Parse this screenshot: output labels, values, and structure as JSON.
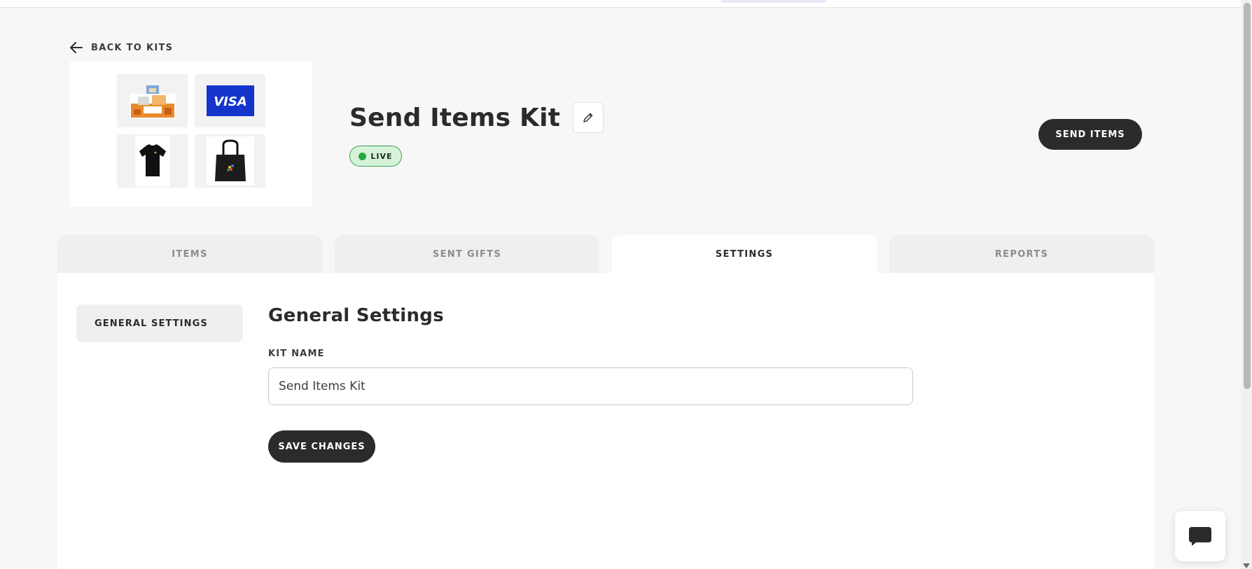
{
  "nav": {
    "back_label": "BACK TO KITS"
  },
  "kit": {
    "title": "Send Items Kit",
    "status": "LIVE",
    "thumbnails": [
      "snack-box",
      "visa-card",
      "black-tshirt",
      "tote-bag"
    ],
    "visa_text": "VISA"
  },
  "actions": {
    "send_label": "SEND ITEMS"
  },
  "tabs": [
    {
      "label": "ITEMS",
      "active": false
    },
    {
      "label": "SENT GIFTS",
      "active": false
    },
    {
      "label": "SETTINGS",
      "active": true
    },
    {
      "label": "REPORTS",
      "active": false
    }
  ],
  "settings": {
    "nav_item": "GENERAL SETTINGS",
    "section_title": "General Settings",
    "kit_name_label": "KIT NAME",
    "kit_name_value": "Send Items Kit",
    "save_label": "SAVE CHANGES"
  },
  "colors": {
    "dark": "#2a2b2d",
    "live_green": "#27a844",
    "live_bg": "#d6f3da",
    "visa_blue": "#1434cb"
  },
  "icons": [
    "arrow-left-icon",
    "pencil-icon",
    "chat-icon"
  ]
}
